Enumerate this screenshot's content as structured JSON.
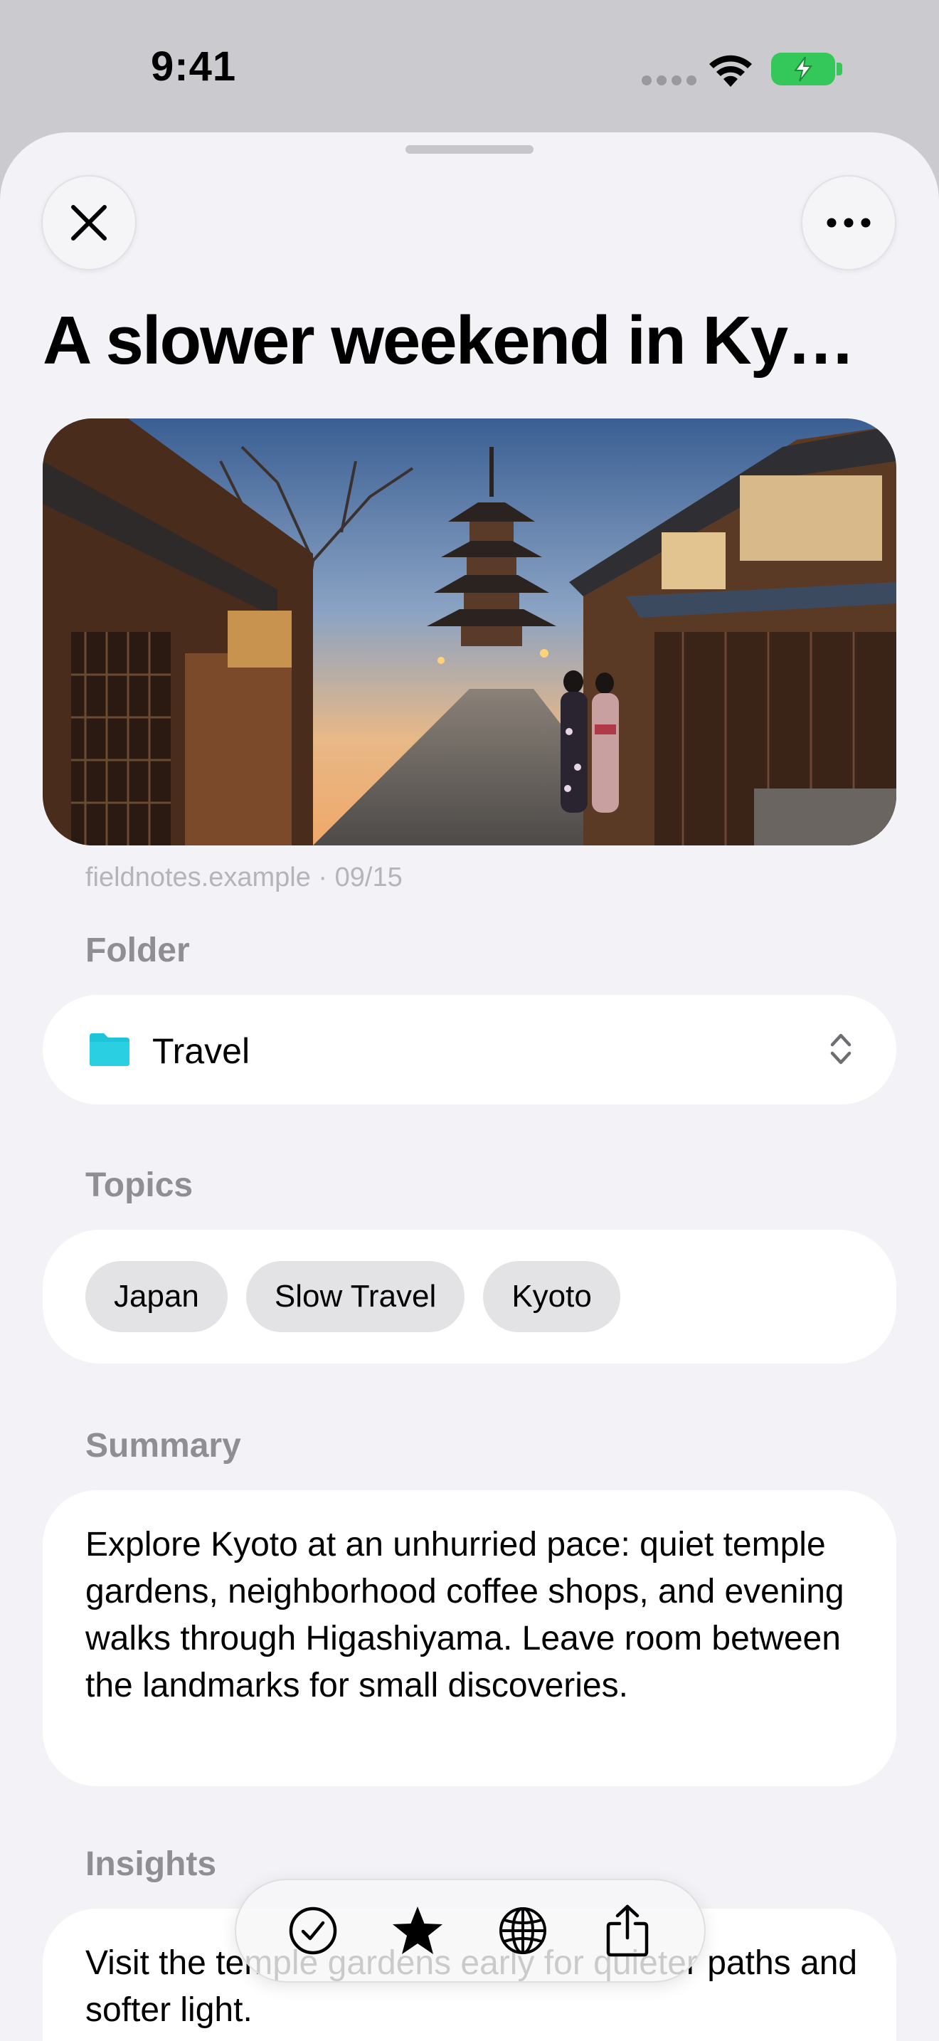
{
  "status_bar": {
    "time": "9:41"
  },
  "header": {
    "title": "A slower weekend in Kyoto",
    "close_icon": "close-icon",
    "more_icon": "ellipsis-icon"
  },
  "article": {
    "source": "fieldnotes.example",
    "date": "09/15",
    "source_line": "fieldnotes.example · 09/15"
  },
  "folder": {
    "label": "Folder",
    "value": "Travel",
    "icon": "folder-icon",
    "icon_color": "#1fc4d8"
  },
  "topics": {
    "label": "Topics",
    "items": [
      "Japan",
      "Slow Travel",
      "Kyoto"
    ]
  },
  "summary": {
    "label": "Summary",
    "text": "Explore Kyoto at an unhurried pace: quiet temple gardens, neighborhood coffee shops, and evening walks through Higashiyama. Leave room between the landmarks for small discoveries."
  },
  "insights": {
    "label": "Insights",
    "text": "Visit the temple gardens early for quieter paths and softer light."
  },
  "toolbar": {
    "items": [
      "checkmark-circle-icon",
      "star-icon",
      "globe-icon",
      "share-icon"
    ]
  },
  "colors": {
    "sheet_background": "#f2f2f7",
    "card_background": "#ffffff",
    "section_label": "#8e8e93",
    "battery": "#34c759"
  }
}
